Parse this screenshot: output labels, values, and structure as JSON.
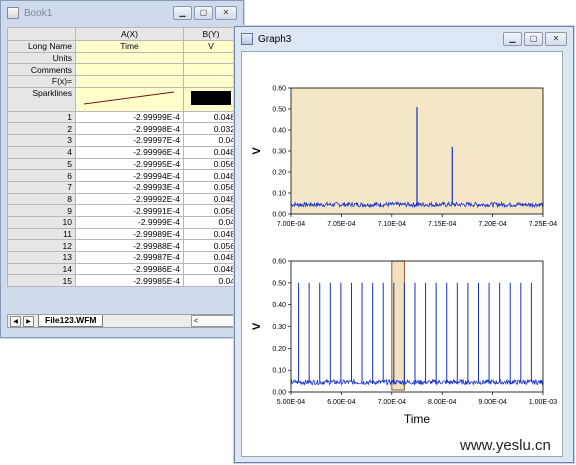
{
  "book_window": {
    "title": "Book1",
    "columns": [
      {
        "header": "A(X)"
      },
      {
        "header": "B(Y)"
      }
    ],
    "row_labels": {
      "long_name": "Long Name",
      "units": "Units",
      "comments": "Comments",
      "fx": "F(x)=",
      "sparklines": "Sparklines"
    },
    "long_names": {
      "a": "Time",
      "b": "V"
    },
    "rows": [
      {
        "i": "1",
        "x": "-2.99999E-4",
        "y": "0.048"
      },
      {
        "i": "2",
        "x": "-2.99998E-4",
        "y": "0.032"
      },
      {
        "i": "3",
        "x": "-2.99997E-4",
        "y": "0.04"
      },
      {
        "i": "4",
        "x": "-2.99996E-4",
        "y": "0.048"
      },
      {
        "i": "5",
        "x": "-2.99995E-4",
        "y": "0.056"
      },
      {
        "i": "6",
        "x": "-2.99994E-4",
        "y": "0.048"
      },
      {
        "i": "7",
        "x": "-2.99993E-4",
        "y": "0.056"
      },
      {
        "i": "8",
        "x": "-2.99992E-4",
        "y": "0.048"
      },
      {
        "i": "9",
        "x": "-2.99991E-4",
        "y": "0.056"
      },
      {
        "i": "10",
        "x": "-2.9999E-4",
        "y": "0.04"
      },
      {
        "i": "11",
        "x": "-2.99989E-4",
        "y": "0.048"
      },
      {
        "i": "12",
        "x": "-2.99988E-4",
        "y": "0.056"
      },
      {
        "i": "13",
        "x": "-2.99987E-4",
        "y": "0.048"
      },
      {
        "i": "14",
        "x": "-2.99986E-4",
        "y": "0.048"
      },
      {
        "i": "15",
        "x": "-2.99985E-4",
        "y": "0.04"
      }
    ],
    "sheet_tab": "File123.WFM"
  },
  "graph_window": {
    "title": "Graph3",
    "colors": {
      "plot_bg": "#f5e6c8",
      "trace": "#1530c8",
      "highlight_fill": "#f5e0bd",
      "highlight_stroke": "#8a5a2a"
    }
  },
  "chart_data": [
    {
      "type": "line",
      "title": "",
      "ylabel": "V",
      "xlabel": "",
      "xlim": [
        0.0007,
        0.000725
      ],
      "ylim": [
        0,
        0.6
      ],
      "x_ticks": [
        "7.00E-04",
        "7.05E-04",
        "7.10E-04",
        "7.15E-04",
        "7.20E-04",
        "7.25E-04"
      ],
      "y_ticks": [
        "0.00",
        "0.10",
        "0.20",
        "0.30",
        "0.40",
        "0.50",
        "0.60"
      ],
      "baseline": 0.045,
      "spikes": [
        {
          "x": 0.0007125,
          "y": 0.51
        },
        {
          "x": 0.000716,
          "y": 0.32
        }
      ]
    },
    {
      "type": "line",
      "title": "",
      "ylabel": "V",
      "xlabel": "Time",
      "xlim": [
        0.0005,
        0.001
      ],
      "ylim": [
        0,
        0.6
      ],
      "x_ticks": [
        "5.00E-04",
        "6.00E-04",
        "7.00E-04",
        "8.00E-04",
        "9.00E-04",
        "1.00E-03"
      ],
      "y_ticks": [
        "0.00",
        "0.10",
        "0.20",
        "0.30",
        "0.40",
        "0.50",
        "0.60"
      ],
      "baseline": 0.045,
      "pulse_x": [
        0.000515,
        0.000536,
        0.000557,
        0.000578,
        0.000599,
        0.00062,
        0.000641,
        0.000662,
        0.000683,
        0.000704,
        0.000725,
        0.000746,
        0.000767,
        0.000788,
        0.000809,
        0.00083,
        0.000851,
        0.000872,
        0.000893,
        0.000914,
        0.000935,
        0.000956,
        0.000977
      ],
      "pulse_y": 0.5,
      "highlight_range": [
        0.0007,
        0.000725
      ]
    }
  ],
  "watermark": "www.yeslu.cn"
}
